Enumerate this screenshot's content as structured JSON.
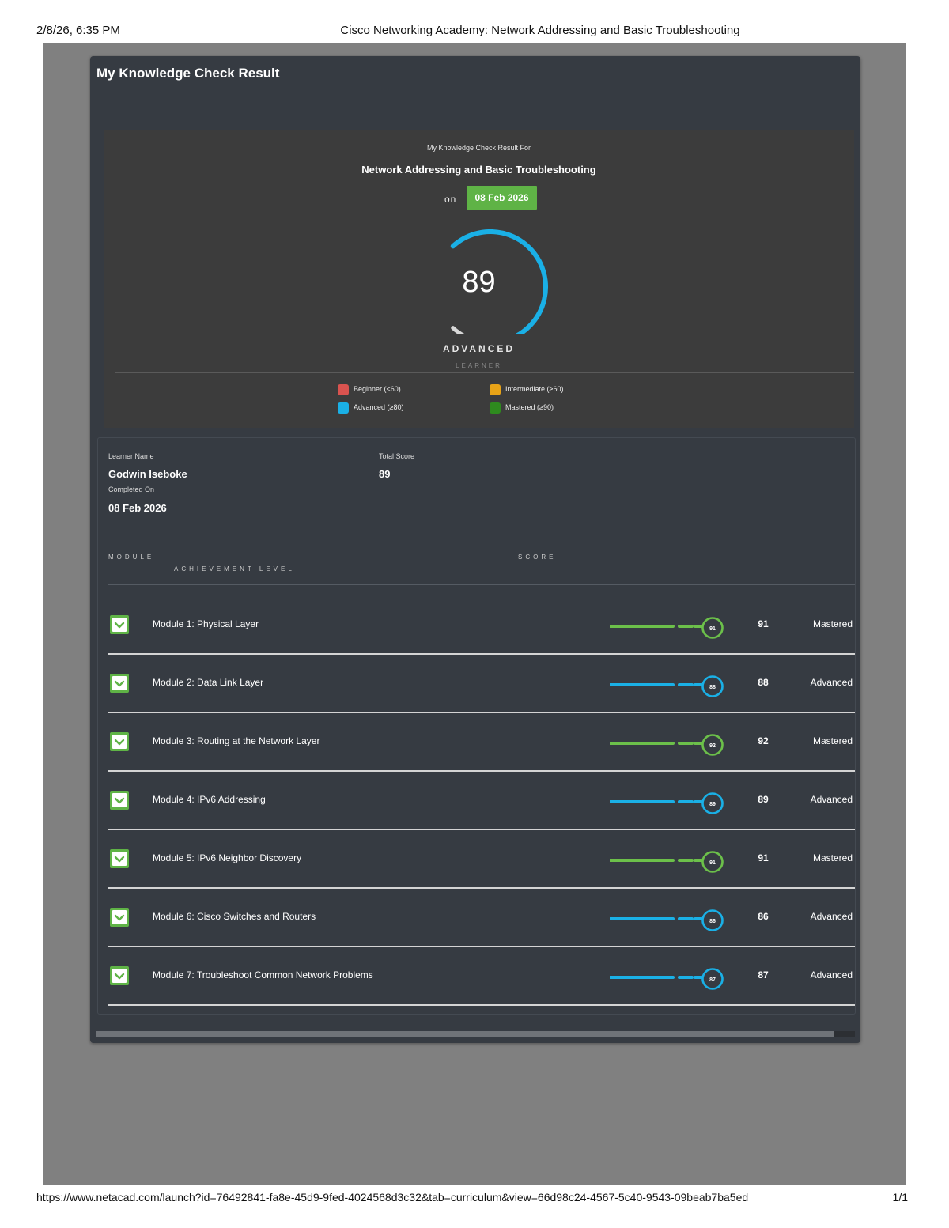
{
  "print": {
    "date": "2/8/26, 6:35 PM",
    "title": "Cisco Networking Academy: Network Addressing and Basic Troubleshooting",
    "url": "https://www.netacad.com/launch?id=76492841-fa8e-45d9-9fed-4024568d3c32&tab=curriculum&view=66d98c24-4567-5c40-9543-09beab7ba5ed",
    "page": "1/1"
  },
  "panel": {
    "title": "My Knowledge Check Result"
  },
  "summary": {
    "result_for": "My Knowledge Check Result For",
    "course": "Network Addressing and Basic Troubleshooting",
    "on_label": "on",
    "date": "08 Feb 2026",
    "score": "89",
    "score_fraction": 0.89,
    "level": "ADVANCED",
    "level_sub": "LEARNER",
    "legend": [
      {
        "label": "Beginner (<60)",
        "color": "#d9534f"
      },
      {
        "label": "Intermediate (≥60)",
        "color": "#e8a317"
      },
      {
        "label": "Advanced (≥80)",
        "color": "#1ab0e6"
      },
      {
        "label": "Mastered (≥90)",
        "color": "#2e8b1e"
      }
    ]
  },
  "details": {
    "learner_label": "Learner Name",
    "learner": "Godwin Iseboke",
    "completed_label": "Completed On",
    "completed": "08 Feb 2026",
    "total_label": "Total Score",
    "total": "89"
  },
  "table": {
    "col_module": "MODULE",
    "col_level": "ACHIEVEMENT LEVEL",
    "col_score": "SCORE",
    "rows": [
      {
        "name": "Module 1: Physical Layer",
        "score": "91",
        "value": 91,
        "badge": "91",
        "level": "Mastered",
        "color": "#6cc04a"
      },
      {
        "name": "Module 2: Data Link Layer",
        "score": "88",
        "value": 88,
        "badge": "88",
        "level": "Advanced",
        "color": "#1ab0e6"
      },
      {
        "name": "Module 3: Routing at the Network Layer",
        "score": "92",
        "value": 92,
        "badge": "92",
        "level": "Mastered",
        "color": "#6cc04a"
      },
      {
        "name": "Module 4: IPv6 Addressing",
        "score": "89",
        "value": 89,
        "badge": "89",
        "level": "Advanced",
        "color": "#1ab0e6"
      },
      {
        "name": "Module 5: IPv6 Neighbor Discovery",
        "score": "91",
        "value": 91,
        "badge": "91",
        "level": "Mastered",
        "color": "#6cc04a"
      },
      {
        "name": "Module 6: Cisco Switches and Routers",
        "score": "86",
        "value": 86,
        "badge": "86",
        "level": "Advanced",
        "color": "#1ab0e6"
      },
      {
        "name": "Module 7: Troubleshoot Common Network Problems",
        "score": "87",
        "value": 87,
        "badge": "87",
        "level": "Advanced",
        "color": "#1ab0e6"
      }
    ]
  }
}
